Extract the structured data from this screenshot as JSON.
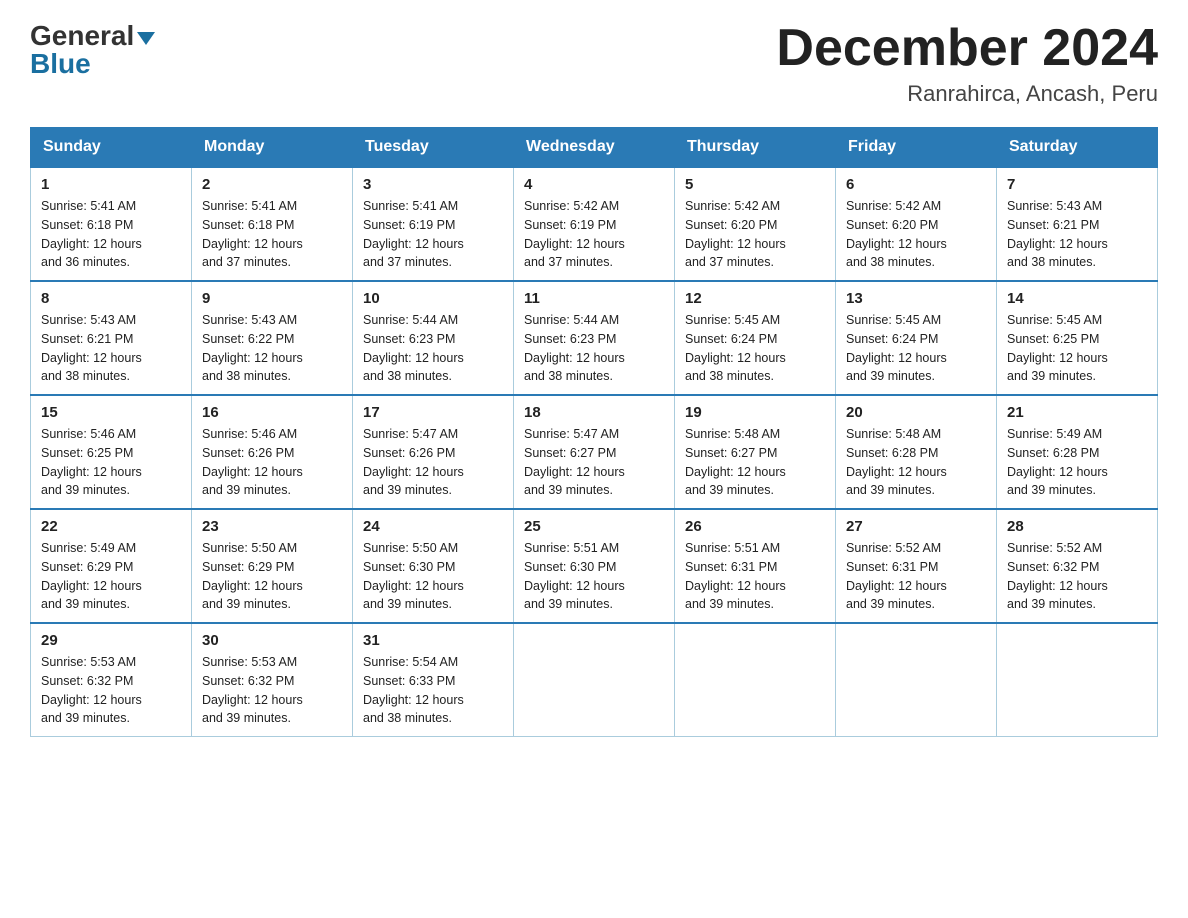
{
  "logo": {
    "general": "General",
    "blue": "Blue"
  },
  "title": "December 2024",
  "subtitle": "Ranrahirca, Ancash, Peru",
  "days_of_week": [
    "Sunday",
    "Monday",
    "Tuesday",
    "Wednesday",
    "Thursday",
    "Friday",
    "Saturday"
  ],
  "weeks": [
    [
      {
        "day": "1",
        "sunrise": "5:41 AM",
        "sunset": "6:18 PM",
        "daylight": "12 hours and 36 minutes."
      },
      {
        "day": "2",
        "sunrise": "5:41 AM",
        "sunset": "6:18 PM",
        "daylight": "12 hours and 37 minutes."
      },
      {
        "day": "3",
        "sunrise": "5:41 AM",
        "sunset": "6:19 PM",
        "daylight": "12 hours and 37 minutes."
      },
      {
        "day": "4",
        "sunrise": "5:42 AM",
        "sunset": "6:19 PM",
        "daylight": "12 hours and 37 minutes."
      },
      {
        "day": "5",
        "sunrise": "5:42 AM",
        "sunset": "6:20 PM",
        "daylight": "12 hours and 37 minutes."
      },
      {
        "day": "6",
        "sunrise": "5:42 AM",
        "sunset": "6:20 PM",
        "daylight": "12 hours and 38 minutes."
      },
      {
        "day": "7",
        "sunrise": "5:43 AM",
        "sunset": "6:21 PM",
        "daylight": "12 hours and 38 minutes."
      }
    ],
    [
      {
        "day": "8",
        "sunrise": "5:43 AM",
        "sunset": "6:21 PM",
        "daylight": "12 hours and 38 minutes."
      },
      {
        "day": "9",
        "sunrise": "5:43 AM",
        "sunset": "6:22 PM",
        "daylight": "12 hours and 38 minutes."
      },
      {
        "day": "10",
        "sunrise": "5:44 AM",
        "sunset": "6:23 PM",
        "daylight": "12 hours and 38 minutes."
      },
      {
        "day": "11",
        "sunrise": "5:44 AM",
        "sunset": "6:23 PM",
        "daylight": "12 hours and 38 minutes."
      },
      {
        "day": "12",
        "sunrise": "5:45 AM",
        "sunset": "6:24 PM",
        "daylight": "12 hours and 38 minutes."
      },
      {
        "day": "13",
        "sunrise": "5:45 AM",
        "sunset": "6:24 PM",
        "daylight": "12 hours and 39 minutes."
      },
      {
        "day": "14",
        "sunrise": "5:45 AM",
        "sunset": "6:25 PM",
        "daylight": "12 hours and 39 minutes."
      }
    ],
    [
      {
        "day": "15",
        "sunrise": "5:46 AM",
        "sunset": "6:25 PM",
        "daylight": "12 hours and 39 minutes."
      },
      {
        "day": "16",
        "sunrise": "5:46 AM",
        "sunset": "6:26 PM",
        "daylight": "12 hours and 39 minutes."
      },
      {
        "day": "17",
        "sunrise": "5:47 AM",
        "sunset": "6:26 PM",
        "daylight": "12 hours and 39 minutes."
      },
      {
        "day": "18",
        "sunrise": "5:47 AM",
        "sunset": "6:27 PM",
        "daylight": "12 hours and 39 minutes."
      },
      {
        "day": "19",
        "sunrise": "5:48 AM",
        "sunset": "6:27 PM",
        "daylight": "12 hours and 39 minutes."
      },
      {
        "day": "20",
        "sunrise": "5:48 AM",
        "sunset": "6:28 PM",
        "daylight": "12 hours and 39 minutes."
      },
      {
        "day": "21",
        "sunrise": "5:49 AM",
        "sunset": "6:28 PM",
        "daylight": "12 hours and 39 minutes."
      }
    ],
    [
      {
        "day": "22",
        "sunrise": "5:49 AM",
        "sunset": "6:29 PM",
        "daylight": "12 hours and 39 minutes."
      },
      {
        "day": "23",
        "sunrise": "5:50 AM",
        "sunset": "6:29 PM",
        "daylight": "12 hours and 39 minutes."
      },
      {
        "day": "24",
        "sunrise": "5:50 AM",
        "sunset": "6:30 PM",
        "daylight": "12 hours and 39 minutes."
      },
      {
        "day": "25",
        "sunrise": "5:51 AM",
        "sunset": "6:30 PM",
        "daylight": "12 hours and 39 minutes."
      },
      {
        "day": "26",
        "sunrise": "5:51 AM",
        "sunset": "6:31 PM",
        "daylight": "12 hours and 39 minutes."
      },
      {
        "day": "27",
        "sunrise": "5:52 AM",
        "sunset": "6:31 PM",
        "daylight": "12 hours and 39 minutes."
      },
      {
        "day": "28",
        "sunrise": "5:52 AM",
        "sunset": "6:32 PM",
        "daylight": "12 hours and 39 minutes."
      }
    ],
    [
      {
        "day": "29",
        "sunrise": "5:53 AM",
        "sunset": "6:32 PM",
        "daylight": "12 hours and 39 minutes."
      },
      {
        "day": "30",
        "sunrise": "5:53 AM",
        "sunset": "6:32 PM",
        "daylight": "12 hours and 39 minutes."
      },
      {
        "day": "31",
        "sunrise": "5:54 AM",
        "sunset": "6:33 PM",
        "daylight": "12 hours and 38 minutes."
      },
      null,
      null,
      null,
      null
    ]
  ],
  "labels": {
    "sunrise": "Sunrise:",
    "sunset": "Sunset:",
    "daylight": "Daylight:"
  }
}
